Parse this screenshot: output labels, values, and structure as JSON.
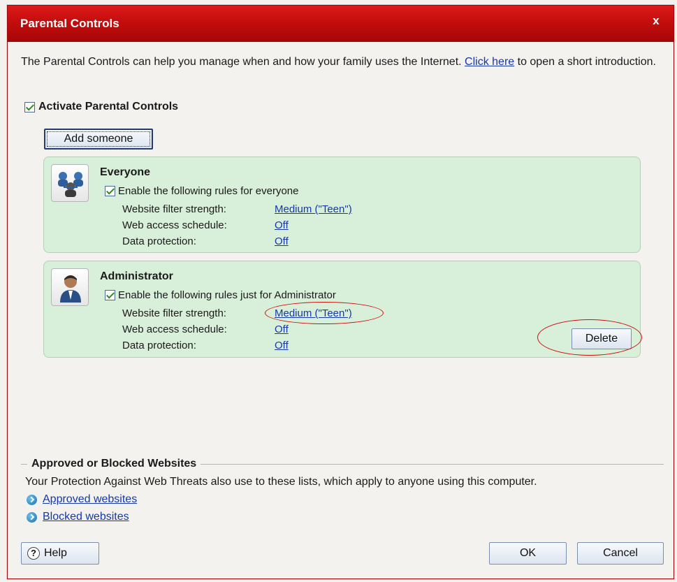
{
  "window": {
    "title": "Parental Controls",
    "close_glyph": "x",
    "title_bar_color": "#c40d0d"
  },
  "intro": {
    "text_before_link": "The Parental Controls can help you manage when and how your family uses the Internet. ",
    "link_text": "Click here",
    "text_after_link": " to open a short introduction."
  },
  "activate": {
    "label": "Activate Parental Controls",
    "checked": true
  },
  "add_someone": {
    "label": "Add someone"
  },
  "profiles": [
    {
      "name": "Everyone",
      "icon": "group-users-icon",
      "enable_label": "Enable the following rules for everyone",
      "rules": [
        {
          "label": "Website filter strength:",
          "value": "Medium (\"Teen\")"
        },
        {
          "label": "Web access schedule:",
          "value": "Off"
        },
        {
          "label": "Data protection:",
          "value": "Off"
        }
      ]
    },
    {
      "name": "Administrator",
      "icon": "user-icon",
      "enable_label": "Enable the following rules just for Administrator",
      "rules": [
        {
          "label": "Website filter strength:",
          "value": "Medium (\"Teen\")"
        },
        {
          "label": "Web access schedule:",
          "value": "Off"
        },
        {
          "label": "Data protection:",
          "value": "Off"
        }
      ],
      "delete_label": "Delete"
    }
  ],
  "websites": {
    "heading": "Approved or Blocked Websites",
    "description": "Your Protection Against Web Threats also use to these lists, which apply to anyone using this computer.",
    "approved_link": "Approved websites",
    "blocked_link": "Blocked websites"
  },
  "footer": {
    "help_label": "Help",
    "ok_label": "OK",
    "cancel_label": "Cancel"
  },
  "colors": {
    "card_background": "#d8efd9",
    "link": "#1638a8",
    "highlight_orange": "#d6811b",
    "annotation_red": "#cc1010"
  }
}
